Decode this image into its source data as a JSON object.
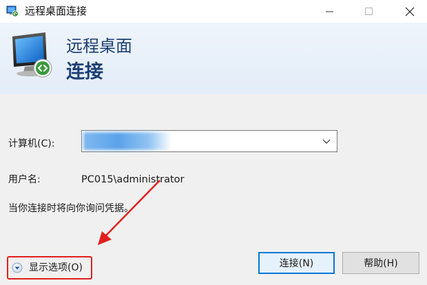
{
  "window": {
    "title": "远程桌面连接"
  },
  "banner": {
    "line1": "远程桌面",
    "line2": "连接"
  },
  "form": {
    "computer_label": "计算机(C):",
    "computer_value": "",
    "username_label": "用户名:",
    "username_value": "PC015\\administrator",
    "notice": "当你连接时将向你询问凭据。"
  },
  "options": {
    "label": "显示选项(O)"
  },
  "buttons": {
    "connect": "连接(N)",
    "help": "帮助(H)"
  },
  "colors": {
    "accent": "#0078d7",
    "banner_text": "#1c3f73",
    "annotation": "#e2201d"
  },
  "icons": {
    "app": "remote-desktop-icon",
    "banner": "remote-desktop-monitor-icon",
    "options": "chevron-down-circle-icon",
    "combo": "chevron-down-icon"
  }
}
